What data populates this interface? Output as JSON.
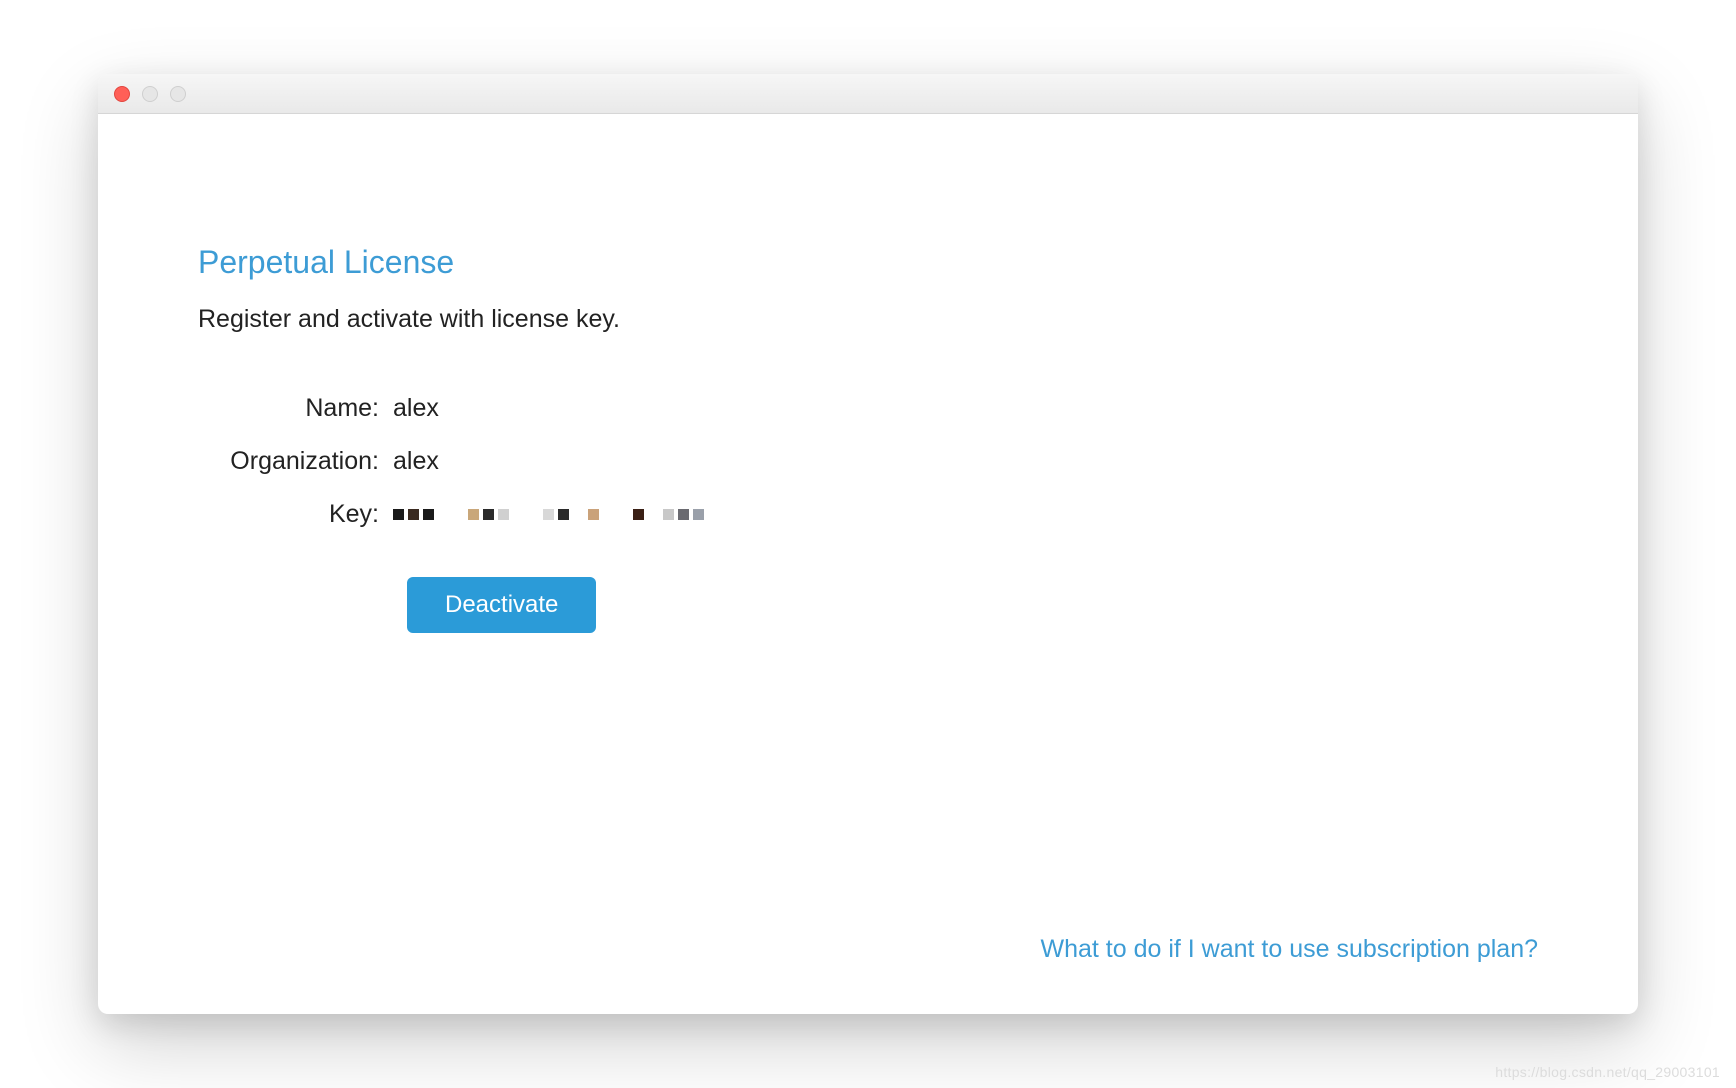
{
  "window": {
    "title": ""
  },
  "license": {
    "heading": "Perpetual License",
    "subheading": "Register and activate with license key.",
    "fields": {
      "name_label": "Name:",
      "name_value": "alex",
      "organization_label": "Organization:",
      "organization_value": "alex",
      "key_label": "Key:",
      "key_value_obscured": true
    },
    "deactivate_label": "Deactivate"
  },
  "footer": {
    "subscription_link": "What to do if I want to use subscription plan?"
  },
  "watermark": "https://blog.csdn.net/qq_29003101",
  "colors": {
    "accent": "#3d9cd5",
    "button": "#2b9bd8",
    "text": "#222222"
  }
}
